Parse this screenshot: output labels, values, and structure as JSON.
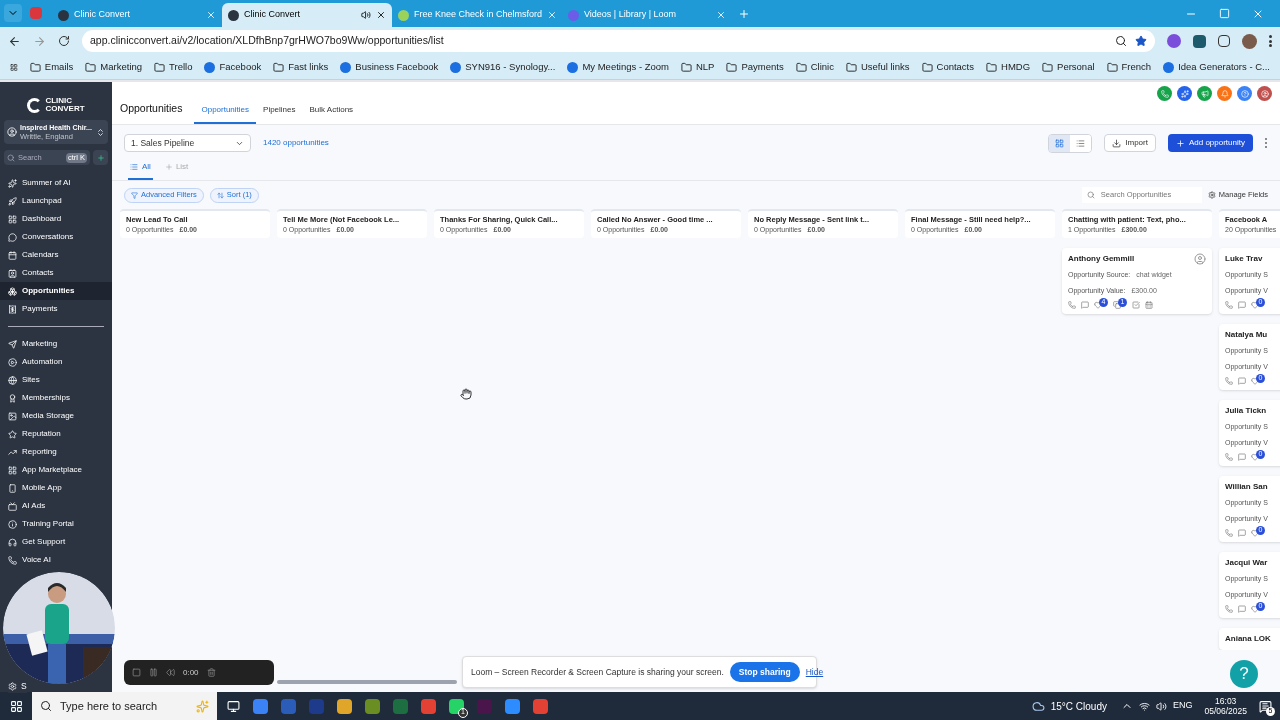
{
  "browser": {
    "tabs": [
      {
        "title": "Clinic Convert",
        "selected": false
      },
      {
        "title": "Clinic Convert",
        "selected": true
      },
      {
        "title": "Free Knee Check in Chelmsford",
        "selected": false
      },
      {
        "title": "Videos | Library | Loom",
        "selected": false
      }
    ],
    "url": "app.clinicconvert.ai/v2/location/XLDfhBnp7grHWO7bo9Ww/opportunities/list",
    "bookmarks": [
      {
        "label": "Emails",
        "kind": "folder"
      },
      {
        "label": "Marketing",
        "kind": "folder"
      },
      {
        "label": "Trello",
        "kind": "folder"
      },
      {
        "label": "Facebook",
        "kind": "site"
      },
      {
        "label": "Fast links",
        "kind": "folder"
      },
      {
        "label": "Business Facebook",
        "kind": "site"
      },
      {
        "label": "SYN916 - Synology...",
        "kind": "site"
      },
      {
        "label": "My Meetings - Zoom",
        "kind": "site"
      },
      {
        "label": "NLP",
        "kind": "folder"
      },
      {
        "label": "Payments",
        "kind": "folder"
      },
      {
        "label": "Clinic",
        "kind": "folder"
      },
      {
        "label": "Useful links",
        "kind": "folder"
      },
      {
        "label": "Contacts",
        "kind": "folder"
      },
      {
        "label": "HMDG",
        "kind": "folder"
      },
      {
        "label": "Personal",
        "kind": "folder"
      },
      {
        "label": "French",
        "kind": "folder"
      },
      {
        "label": "Idea Generators - C...",
        "kind": "site"
      }
    ]
  },
  "sidebar": {
    "logo": [
      "CLINIC",
      "CONVERT"
    ],
    "account": {
      "name": "Inspired Health Chir...",
      "location": "Writtle, England"
    },
    "search": {
      "placeholder": "Search",
      "shortcut": "ctrl K"
    },
    "items": [
      {
        "label": "Summer of AI",
        "selected": false
      },
      {
        "label": "Launchpad",
        "selected": false
      },
      {
        "label": "Dashboard",
        "selected": false
      },
      {
        "label": "Conversations",
        "selected": false
      },
      {
        "label": "Calendars",
        "selected": false
      },
      {
        "label": "Contacts",
        "selected": false
      },
      {
        "label": "Opportunities",
        "selected": true
      },
      {
        "label": "Payments",
        "selected": false
      }
    ],
    "more_items": [
      {
        "label": "Marketing"
      },
      {
        "label": "Automation"
      },
      {
        "label": "Sites"
      },
      {
        "label": "Memberships"
      },
      {
        "label": "Media Storage"
      },
      {
        "label": "Reputation"
      },
      {
        "label": "Reporting"
      },
      {
        "label": "App Marketplace"
      },
      {
        "label": "Mobile App"
      },
      {
        "label": "AI Ads"
      },
      {
        "label": "Training Portal"
      },
      {
        "label": "Get Support"
      },
      {
        "label": "Voice AI"
      }
    ],
    "settings": "S"
  },
  "header": {
    "title": "Opportunities",
    "tabs": [
      {
        "label": "Opportunities",
        "selected": true
      },
      {
        "label": "Pipelines",
        "selected": false
      },
      {
        "label": "Bulk Actions",
        "selected": false
      }
    ]
  },
  "toolbar": {
    "pipeline": "1. Sales Pipeline",
    "count": "1420 opportunities",
    "views": [
      {
        "kind": "grid",
        "selected": true
      },
      {
        "kind": "list",
        "selected": false
      }
    ],
    "import": "Import",
    "add": "Add opportunity"
  },
  "view_tabs": [
    {
      "label": "All",
      "selected": true
    }
  ],
  "add_view": "List",
  "filters": {
    "advanced": "Advanced Filters",
    "sort": "Sort (1)",
    "search_placeholder": "Search Opportunities",
    "manage": "Manage Fields"
  },
  "columns": [
    {
      "title": "New Lead To Call",
      "count": "0 Opportunities",
      "value": "£0.00"
    },
    {
      "title": "Tell Me More (Not Facebook Le...",
      "count": "0 Opportunities",
      "value": "£0.00"
    },
    {
      "title": "Thanks For Sharing, Quick Call...",
      "count": "0 Opportunities",
      "value": "£0.00"
    },
    {
      "title": "Called No Answer - Good time ...",
      "count": "0 Opportunities",
      "value": "£0.00"
    },
    {
      "title": "No Reply Message - Sent link t...",
      "count": "0 Opportunities",
      "value": "£0.00"
    },
    {
      "title": "Final Message - Still need help?...",
      "count": "0 Opportunities",
      "value": "£0.00"
    },
    {
      "title": "Chatting with patient: Text, pho...",
      "count": "1 Opportunities",
      "value": "£300.00",
      "cards": [
        {
          "name": "Anthony Gemmill",
          "fields": [
            {
              "label": "Opportunity Source:",
              "value": "chat widget"
            },
            {
              "label": "Opportunity Value:",
              "value": "£300.00"
            }
          ],
          "badges": [
            "4",
            "1"
          ]
        }
      ]
    },
    {
      "title": "Facebook A",
      "count": "20 Opportunities",
      "cards": [
        {
          "name": "Luke Trav",
          "fields": [
            {
              "label": "Opportunity S"
            },
            {
              "label": "Opportunity V"
            }
          ],
          "badges": [
            "0"
          ]
        },
        {
          "name": "Natalya Mu",
          "fields": [
            {
              "label": "Opportunity S"
            },
            {
              "label": "Opportunity V"
            }
          ],
          "badges": [
            "0"
          ]
        },
        {
          "name": "Julia Tickn",
          "fields": [
            {
              "label": "Opportunity S"
            },
            {
              "label": "Opportunity V"
            }
          ],
          "badges": [
            "0"
          ]
        },
        {
          "name": "Willian San",
          "fields": [
            {
              "label": "Opportunity S"
            },
            {
              "label": "Opportunity V"
            }
          ],
          "badges": [
            "0"
          ]
        },
        {
          "name": "Jacqui War",
          "fields": [
            {
              "label": "Opportunity S"
            },
            {
              "label": "Opportunity V"
            }
          ],
          "badges": [
            "0"
          ]
        },
        {
          "name": "Aniana LOK"
        }
      ]
    }
  ],
  "help": "?",
  "recorder": {
    "time": "0:00"
  },
  "sharing": {
    "message": "Loom – Screen Recorder & Screen Capture is sharing your screen.",
    "stop": "Stop sharing",
    "hide": "Hide"
  },
  "taskbar": {
    "search_placeholder": "Type here to search",
    "whatsapp_badge": "1",
    "weather": "15°C Cloudy",
    "language": "ENG",
    "time": "16:03",
    "date": "05/06/2025",
    "notifications": "5"
  }
}
